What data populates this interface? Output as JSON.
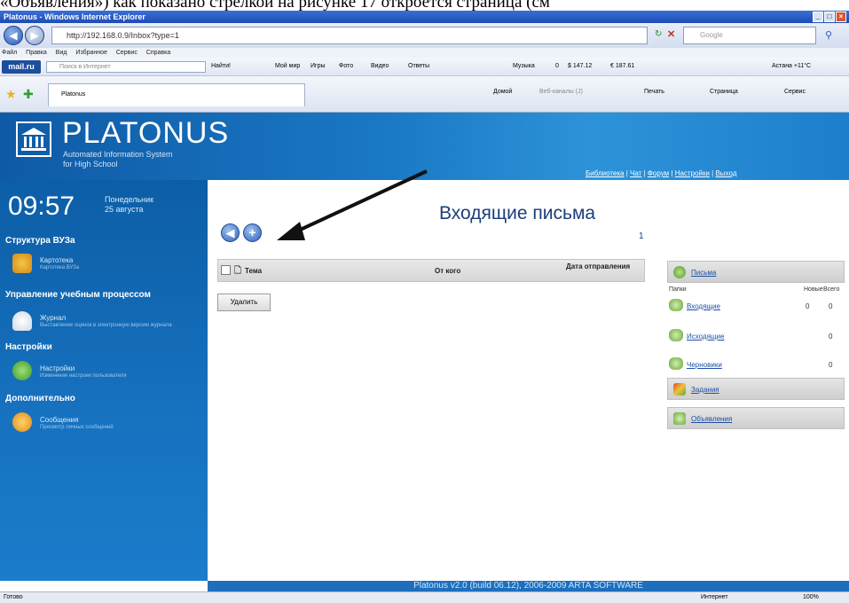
{
  "caption": "«Объявления»)  как показано стрелкой на рисунке 17 откроется страница (см",
  "window": {
    "title": "Platonus - Windows Internet Explorer",
    "controls": [
      "_",
      "□",
      "×"
    ]
  },
  "address": {
    "url": "http://192.168.0.9/Inbox?type=1",
    "search_placeholder": "Google"
  },
  "menu": {
    "items": [
      "Файл",
      "Правка",
      "Вид",
      "Избранное",
      "Сервис",
      "Справка"
    ]
  },
  "mail_toolbar": {
    "logo": "mail.ru",
    "search_placeholder": "Поиск в Интернет",
    "search_button": "Найти!",
    "items": [
      "Мой мир",
      "Игры",
      "Фото",
      "Видео",
      "Ответы",
      "Музыка",
      "0",
      "$ 147.12",
      "€ 187.61",
      "Астана +11°C"
    ]
  },
  "fav_toolbar": {
    "tab_label": "Platonus",
    "items": [
      "Домой",
      "Веб-каналы (J)",
      "Печать",
      "Страница",
      "Сервис"
    ]
  },
  "header": {
    "logo_title": "PLATONUS",
    "logo_sub1": "Automated Information System",
    "logo_sub2": "for High School",
    "links": [
      "Библиотека",
      "Чат",
      "Форум",
      "Настройки",
      "Выход"
    ]
  },
  "sidebar": {
    "time": "09:57",
    "day": "Понедельник",
    "date": "25 августа",
    "sections": [
      {
        "title": "Структура ВУЗа",
        "items": [
          {
            "label": "Картотека",
            "sub": "Картотека ВУЗа"
          }
        ]
      },
      {
        "title": "Управление учебным процессом",
        "items": [
          {
            "label": "Журнал",
            "sub": "Выставление оценок в электронную версию журнала"
          }
        ]
      },
      {
        "title": "Настройки",
        "items": [
          {
            "label": "Настройки",
            "sub": "Изменение настроек пользователя"
          }
        ]
      },
      {
        "title": "Дополнительно",
        "items": [
          {
            "label": "Сообщения",
            "sub": "Просмотр личных сообщений"
          }
        ]
      }
    ]
  },
  "main": {
    "title": "Входящие письма",
    "page_number": "1",
    "columns": [
      "Тема",
      "От кого",
      "Дата отправления"
    ],
    "delete_button": "Удалить"
  },
  "right_panel": {
    "letters_label": "Письма",
    "col_folders": "Папки",
    "col_new": "Новые",
    "col_total": "Всего",
    "folders": [
      {
        "name": "Входящие",
        "new": "0",
        "total": "0"
      },
      {
        "name": "Исходящие",
        "new": "",
        "total": "0"
      },
      {
        "name": "Черновики",
        "new": "",
        "total": "0"
      }
    ],
    "tasks_label": "Задания",
    "announcements_label": "Объявления"
  },
  "footer": {
    "copyright": "Platonus v2.0 (build 06.12), 2006-2009 ARTA SOFTWARE"
  },
  "statusbar": {
    "left": "Готово",
    "zone": "Интернет",
    "zoom": "100%"
  }
}
